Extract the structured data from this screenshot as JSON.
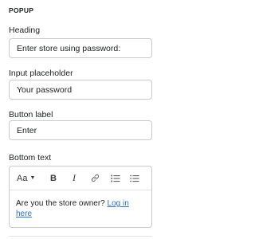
{
  "section": {
    "title": "POPUP"
  },
  "fields": {
    "heading": {
      "label": "Heading",
      "value": "Enter store using password:"
    },
    "input_placeholder": {
      "label": "Input placeholder",
      "value": "Your password"
    },
    "button_label": {
      "label": "Button label",
      "value": "Enter"
    }
  },
  "bottom_text": {
    "label": "Bottom text",
    "toolbar": {
      "text_style": "Aa",
      "text_style_icon": "chevron-down-icon",
      "bold": "B",
      "italic": "I",
      "link_icon": "link-icon",
      "bullet_list_icon": "bullet-list-icon",
      "numbered_list_icon": "numbered-list-icon"
    },
    "content_text": "Are you the store owner? ",
    "content_link": "Log in here"
  }
}
